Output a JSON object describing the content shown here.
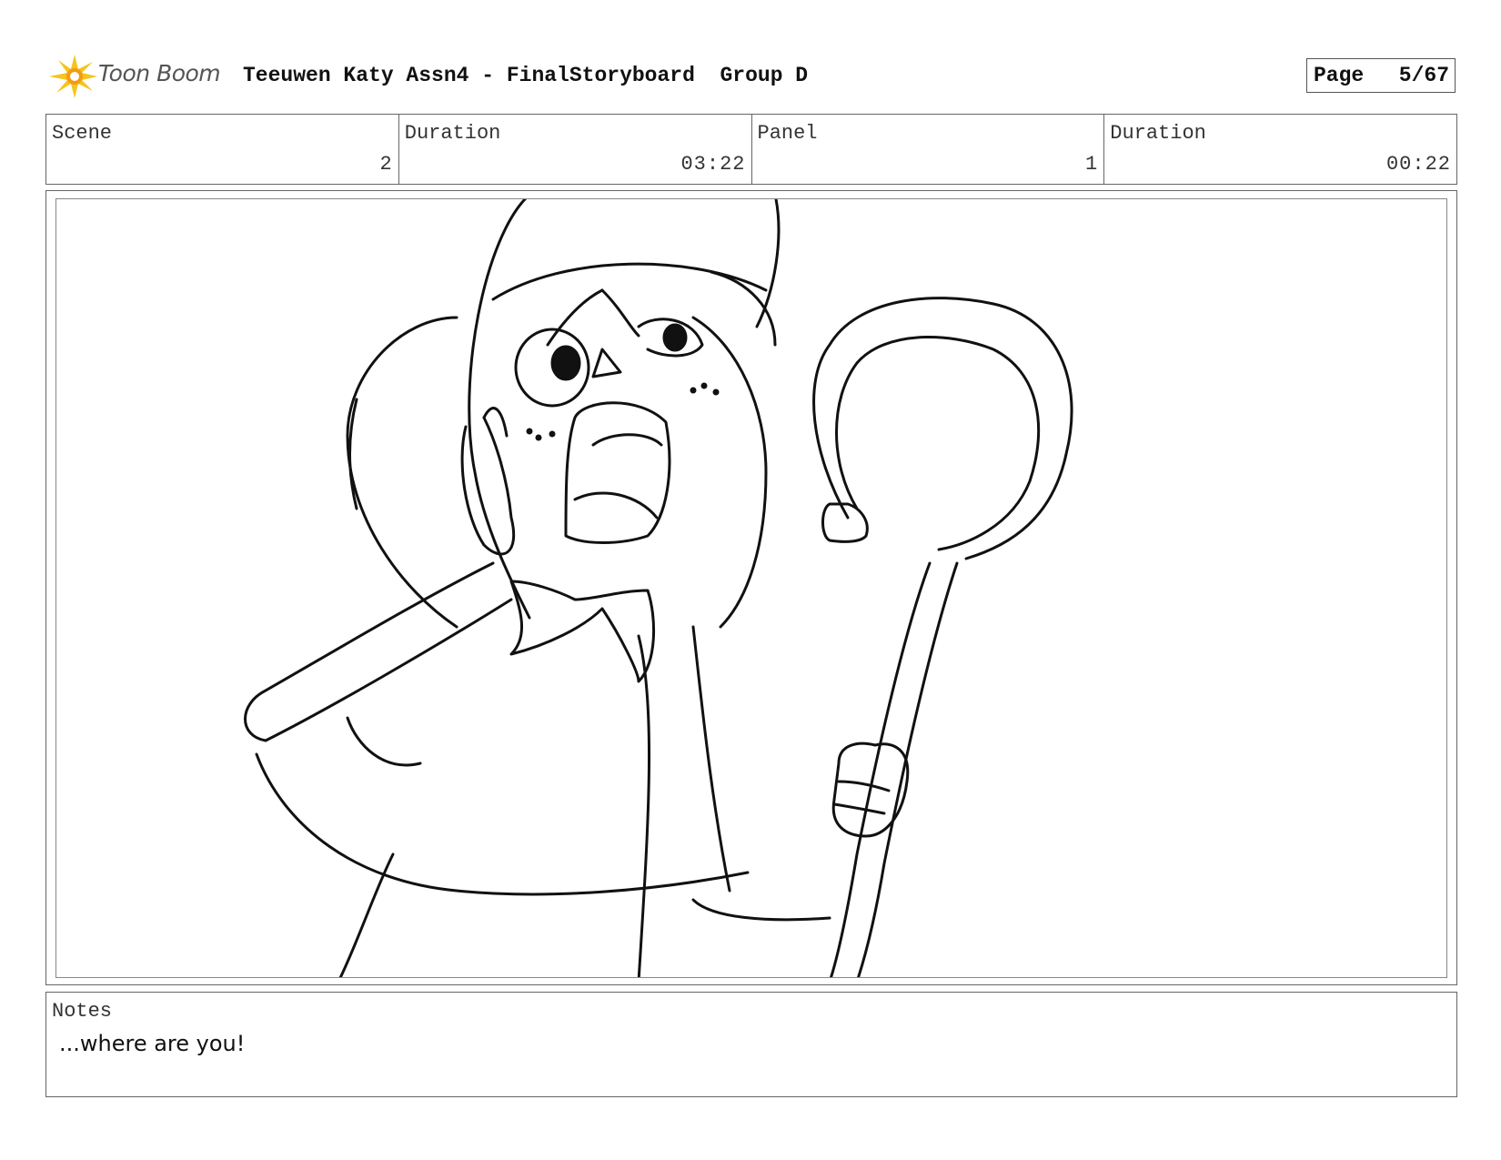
{
  "header": {
    "logo_text": "Toon Boom",
    "title": "Teeuwen Katy Assn4 - FinalStoryboard  Group D",
    "page_label": "Page",
    "page_value": "5/67"
  },
  "info": {
    "scene_label": "Scene",
    "scene_value": "2",
    "scene_duration_label": "Duration",
    "scene_duration_value": "03:22",
    "panel_label": "Panel",
    "panel_value": "1",
    "panel_duration_label": "Duration",
    "panel_duration_value": "00:22"
  },
  "notes": {
    "label": "Notes",
    "text": "...where are you!"
  },
  "icons": {
    "logo": "starburst-logo-icon"
  },
  "colors": {
    "logo_yellow": "#f5c518",
    "logo_orange": "#f39c12"
  }
}
